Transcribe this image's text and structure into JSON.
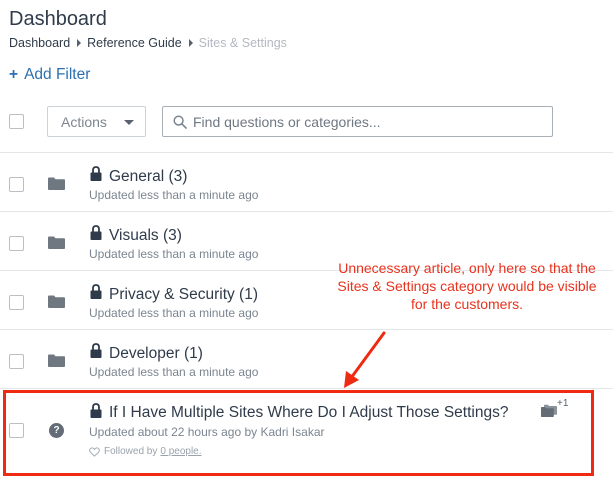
{
  "header": {
    "title": "Dashboard",
    "breadcrumb": [
      "Dashboard",
      "Reference Guide",
      "Sites & Settings"
    ]
  },
  "toolbar": {
    "add_filter_icon": "+",
    "add_filter_label": "Add Filter",
    "actions_label": "Actions",
    "search_placeholder": "Find questions or categories..."
  },
  "categories": [
    {
      "title": "General (3)",
      "meta": "Updated less than a minute ago"
    },
    {
      "title": "Visuals (3)",
      "meta": "Updated less than a minute ago"
    },
    {
      "title": "Privacy & Security (1)",
      "meta": "Updated less than a minute ago"
    },
    {
      "title": "Developer (1)",
      "meta": "Updated less than a minute ago"
    }
  ],
  "article": {
    "icon": "?",
    "title": "If I Have Multiple Sites Where Do I Adjust Those Settings?",
    "meta": "Updated about 22 hours ago by Kadri Isakar",
    "followed_prefix": "Followed by",
    "followed_link": "0 people.",
    "category_count": "+1"
  },
  "annotation": {
    "text": "Unnecessary article, only here so that the Sites & Settings category would be visible for the customers.",
    "color": "#e8321d"
  },
  "colors": {
    "link": "#2d6fb1",
    "text": "#2f3b4a",
    "muted": "#7a8591",
    "highlight": "#ee2a12"
  },
  "icons": [
    "folder-icon",
    "lock-icon",
    "search-icon",
    "question-icon",
    "heart-icon",
    "categories-icon",
    "chevron-right-icon",
    "caret-down-icon"
  ]
}
